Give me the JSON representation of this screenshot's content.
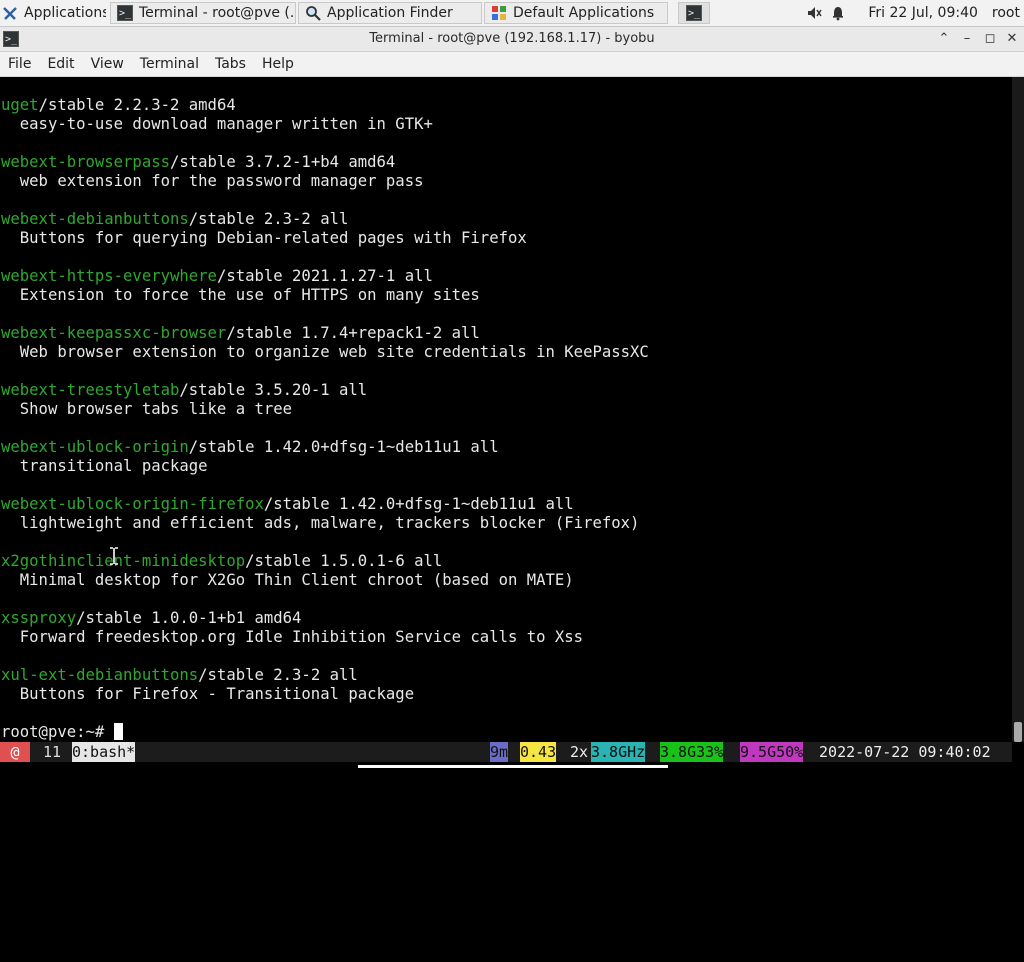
{
  "panel": {
    "tasks": [
      {
        "label": "Applications",
        "icon": "xfce-mouse-icon"
      },
      {
        "label": "Terminal - root@pve (...",
        "icon": "terminal-icon"
      },
      {
        "label": "Application Finder",
        "icon": "magnifier-icon"
      },
      {
        "label": "Default Applications",
        "icon": "colorful-grid-icon"
      }
    ],
    "clock": "Fri 22 Jul, 09:40",
    "user": "root"
  },
  "window": {
    "title": "Terminal - root@pve (192.168.1.17) - byobu",
    "menu": [
      "File",
      "Edit",
      "View",
      "Terminal",
      "Tabs",
      "Help"
    ]
  },
  "terminal": {
    "entries": [
      {
        "pkg": "uget",
        "rest": "/stable 2.2.3-2 amd64",
        "desc": "  easy-to-use download manager written in GTK+"
      },
      {
        "pkg": "webext-browserpass",
        "rest": "/stable 3.7.2-1+b4 amd64",
        "desc": "  web extension for the password manager pass"
      },
      {
        "pkg": "webext-debianbuttons",
        "rest": "/stable 2.3-2 all",
        "desc": "  Buttons for querying Debian-related pages with Firefox"
      },
      {
        "pkg": "webext-https-everywhere",
        "rest": "/stable 2021.1.27-1 all",
        "desc": "  Extension to force the use of HTTPS on many sites"
      },
      {
        "pkg": "webext-keepassxc-browser",
        "rest": "/stable 1.7.4+repack1-2 all",
        "desc": "  Web browser extension to organize web site credentials in KeePassXC"
      },
      {
        "pkg": "webext-treestyletab",
        "rest": "/stable 3.5.20-1 all",
        "desc": "  Show browser tabs like a tree"
      },
      {
        "pkg": "webext-ublock-origin",
        "rest": "/stable 1.42.0+dfsg-1~deb11u1 all",
        "desc": "  transitional package"
      },
      {
        "pkg": "webext-ublock-origin-firefox",
        "rest": "/stable 1.42.0+dfsg-1~deb11u1 all",
        "desc": "  lightweight and efficient ads, malware, trackers blocker (Firefox)"
      },
      {
        "pkg": "x2gothinclient-minidesktop",
        "rest": "/stable 1.5.0.1-6 all",
        "desc": "  Minimal desktop for X2Go Thin Client chroot (based on MATE)"
      },
      {
        "pkg": "xssproxy",
        "rest": "/stable 1.0.0-1+b1 amd64",
        "desc": "  Forward freedesktop.org Idle Inhibition Service calls to Xss"
      },
      {
        "pkg": "xul-ext-debianbuttons",
        "rest": "/stable 2.3-2 all",
        "desc": "  Buttons for Firefox - Transitional package"
      }
    ],
    "prompt": "root@pve:~# "
  },
  "byobu": {
    "logo": " @ ",
    "updates": " 11 ",
    "window": "0:bash*",
    "uptime": "9m",
    "load": "0.43",
    "cpu_count": " 2x",
    "cpu_freq": "3.8GHz",
    "mem_total": "3.8G",
    "mem_pct": "33%",
    "disk_total": "9.5G",
    "disk_pct": "50%",
    "datetime": " 2022-07-22 09:40:02"
  },
  "colors": {
    "package": "#2fa82f",
    "logo_bg": "#e05050",
    "uptime_bg": "#6b6bc8",
    "load_bg": "#f5e642",
    "cpu_bg": "#29b3b3",
    "mem_bg": "#19c219",
    "disk_bg": "#c038c0"
  }
}
